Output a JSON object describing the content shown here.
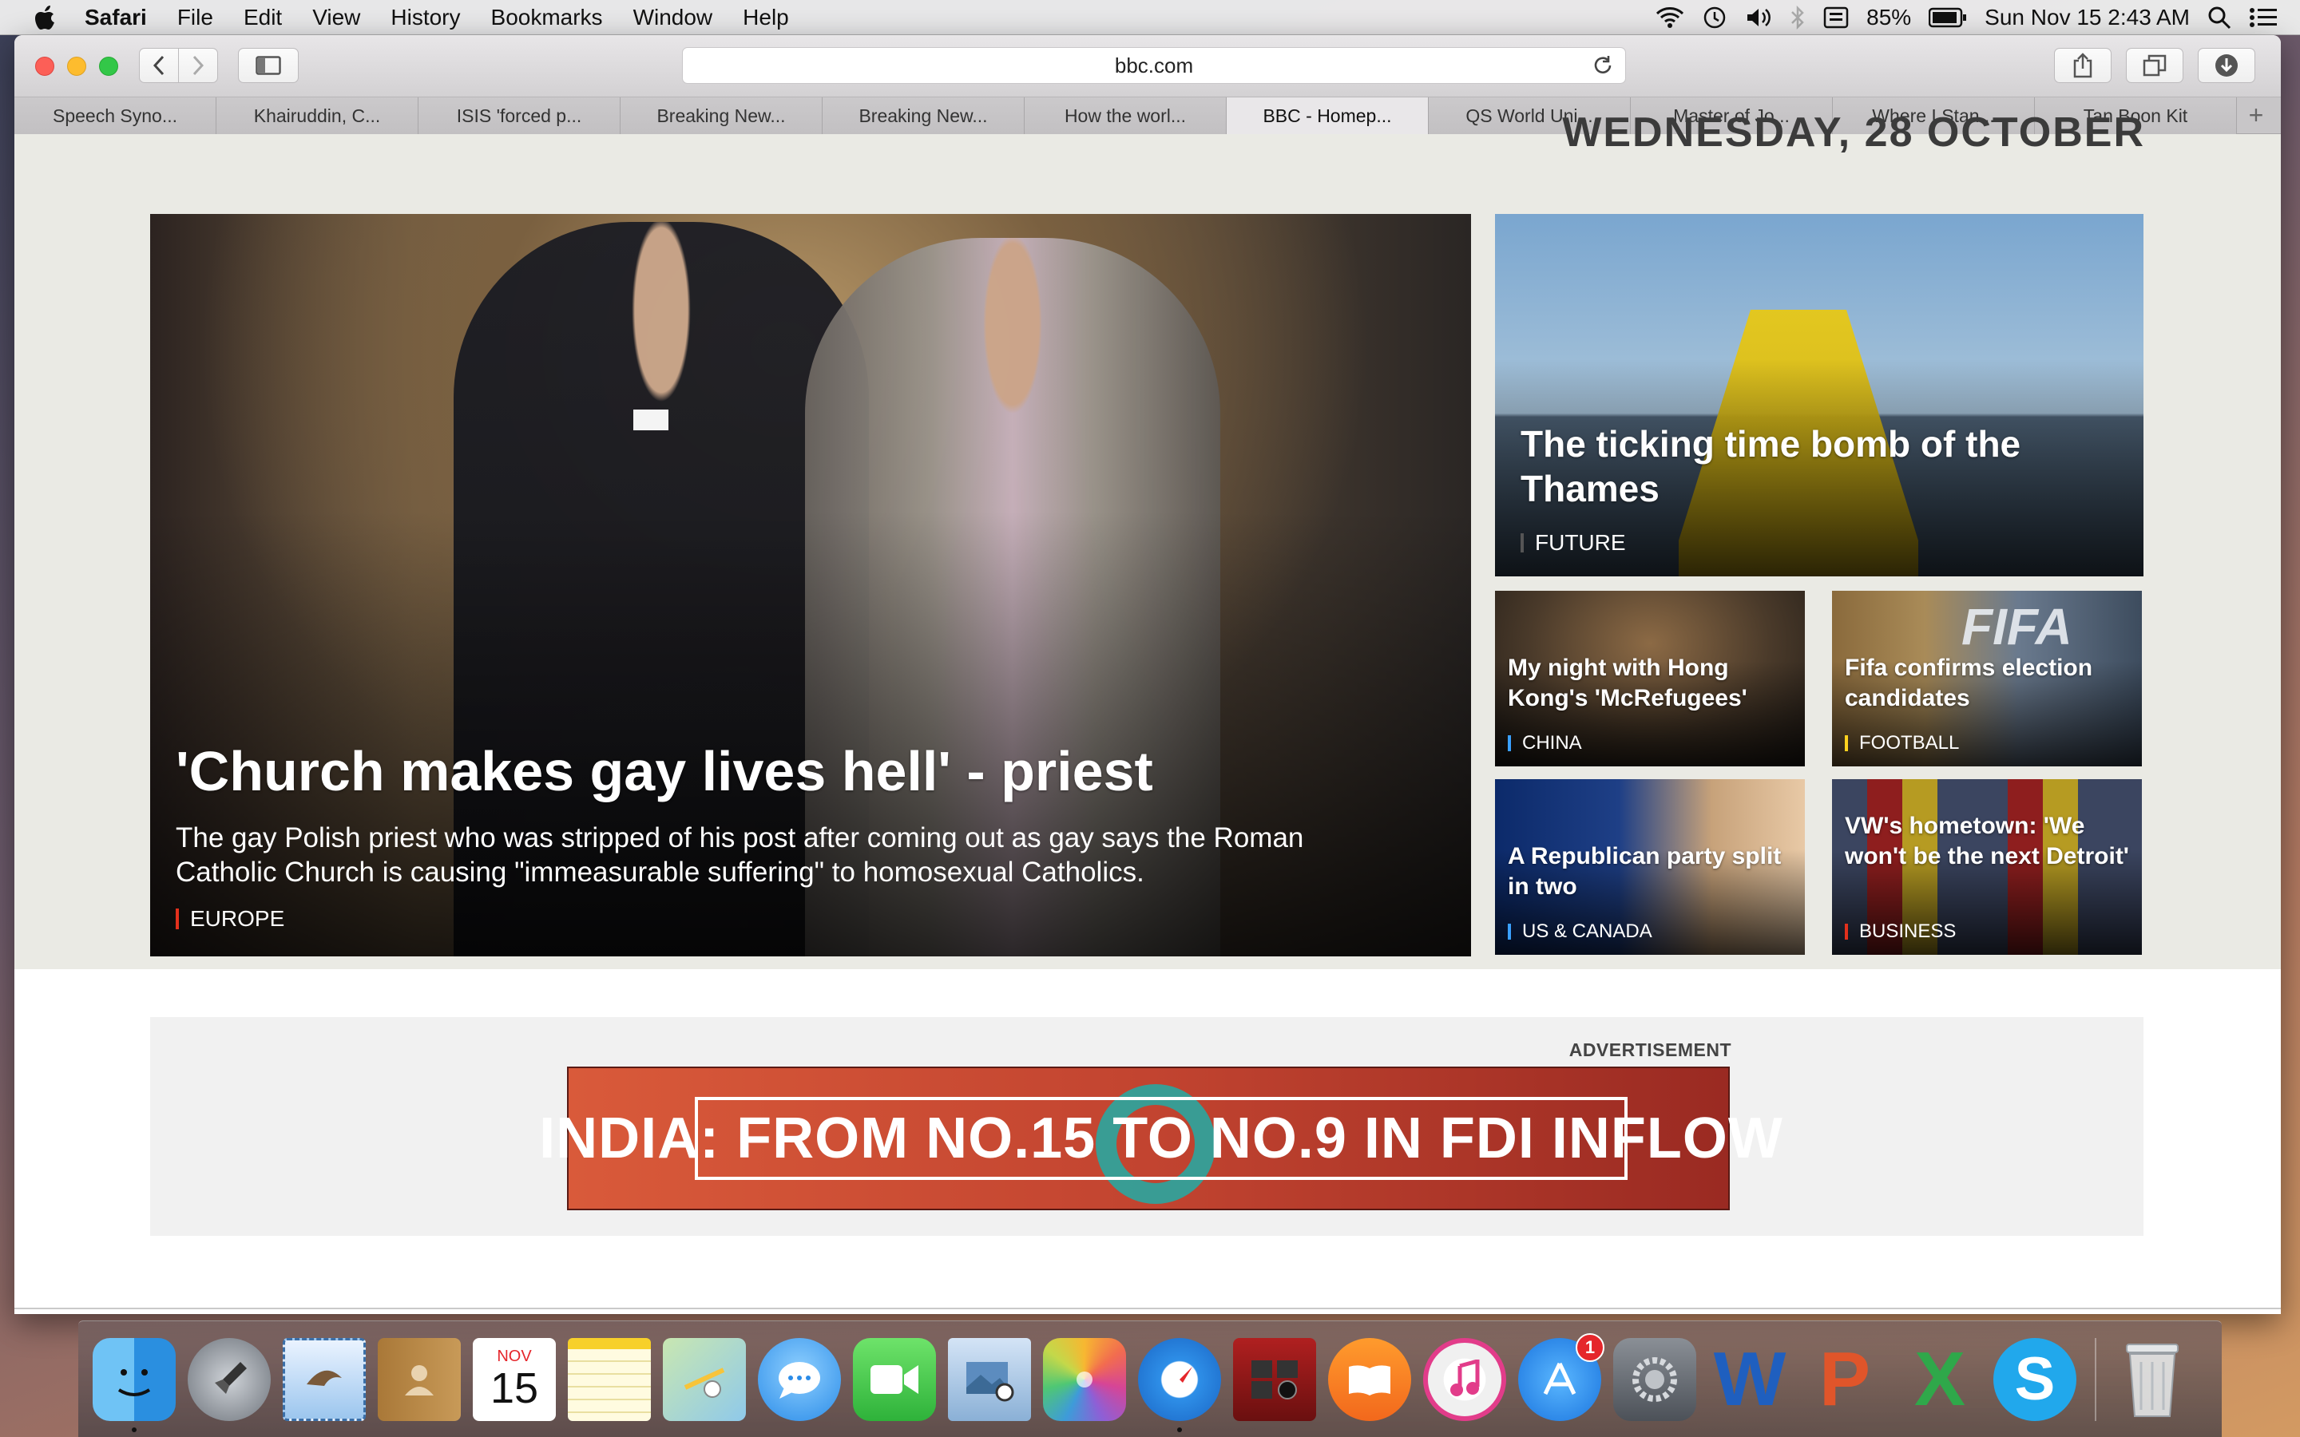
{
  "menubar": {
    "app_name": "Safari",
    "items": [
      "File",
      "Edit",
      "View",
      "History",
      "Bookmarks",
      "Window",
      "Help"
    ],
    "battery": "85%",
    "datetime": "Sun Nov 15  2:43 AM"
  },
  "browser": {
    "url": "bbc.com",
    "tabs": [
      {
        "label": "Speech Syno..."
      },
      {
        "label": "Khairuddin, C..."
      },
      {
        "label": "ISIS 'forced p..."
      },
      {
        "label": "Breaking New..."
      },
      {
        "label": "Breaking New..."
      },
      {
        "label": "How the worl..."
      },
      {
        "label": "BBC - Homep..."
      },
      {
        "label": "QS World Uni..."
      },
      {
        "label": "Master of Jo..."
      },
      {
        "label": "Where I Stan..."
      },
      {
        "label": "Tan Boon Kit"
      }
    ],
    "active_tab_index": 6
  },
  "page": {
    "date_heading": "WEDNESDAY, 28 OCTOBER",
    "main_story": {
      "title": "'Church makes gay lives hell' - priest",
      "summary": "The gay Polish priest who was stripped of his post after coming out as gay says the Roman Catholic Church is causing \"immeasurable suffering\" to homosexual Catholics.",
      "section": "EUROPE"
    },
    "side_stories": [
      {
        "title": "The ticking time bomb of the Thames",
        "section": "FUTURE"
      },
      {
        "title": "My night with Hong Kong's 'McRefugees'",
        "section": "CHINA"
      },
      {
        "title": "Fifa confirms election candidates",
        "section": "FOOTBALL",
        "image_text": "FIFA"
      },
      {
        "title": "A Republican party split in two",
        "section": "US & CANADA"
      },
      {
        "title": "VW's hometown: 'We won't be the next Detroit'",
        "section": "BUSINESS"
      }
    ],
    "advertisement": {
      "label": "ADVERTISEMENT",
      "banner_text": "INDIA: FROM NO.15 TO NO.9 IN FDI INFLOW"
    }
  },
  "dock": {
    "calendar_month": "NOV",
    "calendar_day": "15",
    "app_store_badge": "1",
    "word_letter": "W",
    "powerpoint_letter": "P",
    "excel_letter": "X",
    "skype_letter": "S"
  },
  "colors": {
    "bbc_red": "#e3301c",
    "bbc_yellow": "#ffd21f",
    "bbc_blue": "#3aa0ff"
  }
}
